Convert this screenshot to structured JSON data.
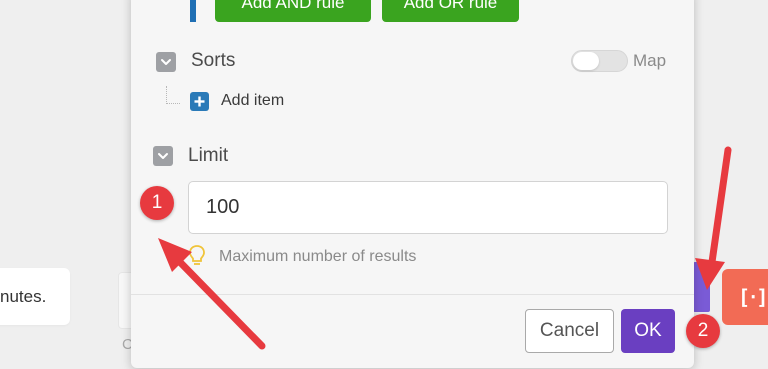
{
  "background": {
    "toast_text": "nutes.",
    "card_fragment": "C",
    "module_icon": "[‧]"
  },
  "filter": {
    "and_button": "Add AND rule",
    "or_button": "Add OR rule"
  },
  "sorts": {
    "label": "Sorts",
    "map_toggle_label": "Map",
    "map_toggle_on": false,
    "add_item_label": "Add item"
  },
  "limit": {
    "label": "Limit",
    "value": "100",
    "hint": "Maximum number of results"
  },
  "footer": {
    "cancel_label": "Cancel",
    "ok_label": "OK"
  },
  "annotations": {
    "badge_1": "1",
    "badge_2": "2",
    "color": "#e73a3f"
  },
  "colors": {
    "accent": "#6a3fc1",
    "primary_blue": "#2a7ab8",
    "success_green": "#3aa41f",
    "module_orange": "#f26b55"
  }
}
